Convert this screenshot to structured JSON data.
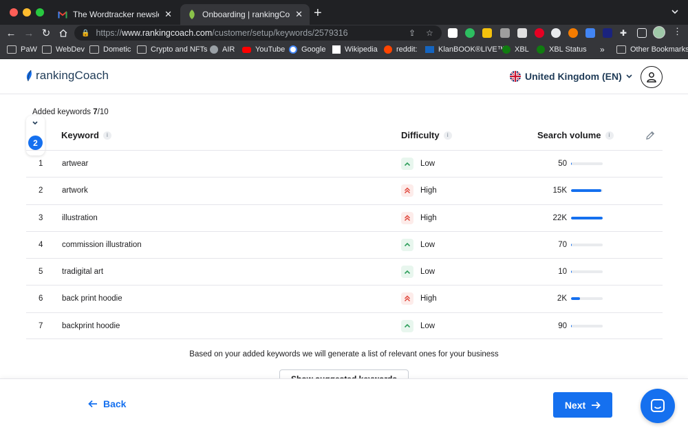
{
  "browser": {
    "tabs": [
      {
        "title": "The Wordtracker newsletter: P",
        "close": "✕"
      },
      {
        "title": "Onboarding | rankingCoach",
        "close": "✕"
      }
    ],
    "new_tab": "+",
    "url": {
      "proto": "https://",
      "host": "www.rankingcoach.com",
      "path": "/customer/setup/keywords/2579316"
    },
    "bookmarks": [
      "PaW",
      "WebDev",
      "Dometic",
      "Crypto and NFTs",
      "AIR",
      "YouTube",
      "Google",
      "Wikipedia",
      "reddit:",
      "KlanBOOK®LIVE™",
      "XBL",
      "XBL Status",
      "Other Bookmarks"
    ],
    "bookmarks_more": "»"
  },
  "header": {
    "logo": "rankingCoach",
    "country": "United Kingdom (EN)"
  },
  "summary": {
    "label": "Added keywords ",
    "count": "7",
    "total": "/10",
    "step": "2"
  },
  "table": {
    "headers": {
      "keyword": "Keyword",
      "difficulty": "Difficulty",
      "volume": "Search volume"
    },
    "info": "i",
    "rows": [
      {
        "idx": "1",
        "keyword": "artwear",
        "difficulty": "Low",
        "volume": "50",
        "volume_fraction": 0.01
      },
      {
        "idx": "2",
        "keyword": "artwork",
        "difficulty": "High",
        "volume": "15K",
        "volume_fraction": 0.95
      },
      {
        "idx": "3",
        "keyword": "illustration",
        "difficulty": "High",
        "volume": "22K",
        "volume_fraction": 1.0
      },
      {
        "idx": "4",
        "keyword": "commission illustration",
        "difficulty": "Low",
        "volume": "70",
        "volume_fraction": 0.01
      },
      {
        "idx": "5",
        "keyword": "tradigital art",
        "difficulty": "Low",
        "volume": "10",
        "volume_fraction": 0.0
      },
      {
        "idx": "6",
        "keyword": "back print hoodie",
        "difficulty": "High",
        "volume": "2K",
        "volume_fraction": 0.28
      },
      {
        "idx": "7",
        "keyword": "backprint hoodie",
        "difficulty": "Low",
        "volume": "90",
        "volume_fraction": 0.02
      }
    ]
  },
  "info_text": "Based on your added keywords we will generate a list of relevant ones for your business",
  "suggest_button": "Show suggested keywords",
  "footer": {
    "back": "Back",
    "next": "Next"
  },
  "colors": {
    "accent": "#1570ef",
    "low": "#2e9e5b",
    "high": "#e0453a"
  }
}
